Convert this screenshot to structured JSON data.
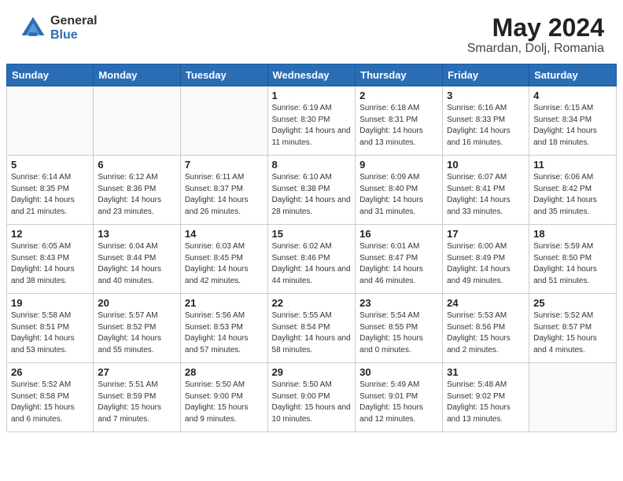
{
  "header": {
    "logo_general": "General",
    "logo_blue": "Blue",
    "month_year": "May 2024",
    "location": "Smardan, Dolj, Romania"
  },
  "weekdays": [
    "Sunday",
    "Monday",
    "Tuesday",
    "Wednesday",
    "Thursday",
    "Friday",
    "Saturday"
  ],
  "weeks": [
    [
      {
        "day": "",
        "sunrise": "",
        "sunset": "",
        "daylight": ""
      },
      {
        "day": "",
        "sunrise": "",
        "sunset": "",
        "daylight": ""
      },
      {
        "day": "",
        "sunrise": "",
        "sunset": "",
        "daylight": ""
      },
      {
        "day": "1",
        "sunrise": "6:19 AM",
        "sunset": "8:30 PM",
        "daylight": "14 hours and 11 minutes."
      },
      {
        "day": "2",
        "sunrise": "6:18 AM",
        "sunset": "8:31 PM",
        "daylight": "14 hours and 13 minutes."
      },
      {
        "day": "3",
        "sunrise": "6:16 AM",
        "sunset": "8:33 PM",
        "daylight": "14 hours and 16 minutes."
      },
      {
        "day": "4",
        "sunrise": "6:15 AM",
        "sunset": "8:34 PM",
        "daylight": "14 hours and 18 minutes."
      }
    ],
    [
      {
        "day": "5",
        "sunrise": "6:14 AM",
        "sunset": "8:35 PM",
        "daylight": "14 hours and 21 minutes."
      },
      {
        "day": "6",
        "sunrise": "6:12 AM",
        "sunset": "8:36 PM",
        "daylight": "14 hours and 23 minutes."
      },
      {
        "day": "7",
        "sunrise": "6:11 AM",
        "sunset": "8:37 PM",
        "daylight": "14 hours and 26 minutes."
      },
      {
        "day": "8",
        "sunrise": "6:10 AM",
        "sunset": "8:38 PM",
        "daylight": "14 hours and 28 minutes."
      },
      {
        "day": "9",
        "sunrise": "6:09 AM",
        "sunset": "8:40 PM",
        "daylight": "14 hours and 31 minutes."
      },
      {
        "day": "10",
        "sunrise": "6:07 AM",
        "sunset": "8:41 PM",
        "daylight": "14 hours and 33 minutes."
      },
      {
        "day": "11",
        "sunrise": "6:06 AM",
        "sunset": "8:42 PM",
        "daylight": "14 hours and 35 minutes."
      }
    ],
    [
      {
        "day": "12",
        "sunrise": "6:05 AM",
        "sunset": "8:43 PM",
        "daylight": "14 hours and 38 minutes."
      },
      {
        "day": "13",
        "sunrise": "6:04 AM",
        "sunset": "8:44 PM",
        "daylight": "14 hours and 40 minutes."
      },
      {
        "day": "14",
        "sunrise": "6:03 AM",
        "sunset": "8:45 PM",
        "daylight": "14 hours and 42 minutes."
      },
      {
        "day": "15",
        "sunrise": "6:02 AM",
        "sunset": "8:46 PM",
        "daylight": "14 hours and 44 minutes."
      },
      {
        "day": "16",
        "sunrise": "6:01 AM",
        "sunset": "8:47 PM",
        "daylight": "14 hours and 46 minutes."
      },
      {
        "day": "17",
        "sunrise": "6:00 AM",
        "sunset": "8:49 PM",
        "daylight": "14 hours and 49 minutes."
      },
      {
        "day": "18",
        "sunrise": "5:59 AM",
        "sunset": "8:50 PM",
        "daylight": "14 hours and 51 minutes."
      }
    ],
    [
      {
        "day": "19",
        "sunrise": "5:58 AM",
        "sunset": "8:51 PM",
        "daylight": "14 hours and 53 minutes."
      },
      {
        "day": "20",
        "sunrise": "5:57 AM",
        "sunset": "8:52 PM",
        "daylight": "14 hours and 55 minutes."
      },
      {
        "day": "21",
        "sunrise": "5:56 AM",
        "sunset": "8:53 PM",
        "daylight": "14 hours and 57 minutes."
      },
      {
        "day": "22",
        "sunrise": "5:55 AM",
        "sunset": "8:54 PM",
        "daylight": "14 hours and 58 minutes."
      },
      {
        "day": "23",
        "sunrise": "5:54 AM",
        "sunset": "8:55 PM",
        "daylight": "15 hours and 0 minutes."
      },
      {
        "day": "24",
        "sunrise": "5:53 AM",
        "sunset": "8:56 PM",
        "daylight": "15 hours and 2 minutes."
      },
      {
        "day": "25",
        "sunrise": "5:52 AM",
        "sunset": "8:57 PM",
        "daylight": "15 hours and 4 minutes."
      }
    ],
    [
      {
        "day": "26",
        "sunrise": "5:52 AM",
        "sunset": "8:58 PM",
        "daylight": "15 hours and 6 minutes."
      },
      {
        "day": "27",
        "sunrise": "5:51 AM",
        "sunset": "8:59 PM",
        "daylight": "15 hours and 7 minutes."
      },
      {
        "day": "28",
        "sunrise": "5:50 AM",
        "sunset": "9:00 PM",
        "daylight": "15 hours and 9 minutes."
      },
      {
        "day": "29",
        "sunrise": "5:50 AM",
        "sunset": "9:00 PM",
        "daylight": "15 hours and 10 minutes."
      },
      {
        "day": "30",
        "sunrise": "5:49 AM",
        "sunset": "9:01 PM",
        "daylight": "15 hours and 12 minutes."
      },
      {
        "day": "31",
        "sunrise": "5:48 AM",
        "sunset": "9:02 PM",
        "daylight": "15 hours and 13 minutes."
      },
      {
        "day": "",
        "sunrise": "",
        "sunset": "",
        "daylight": ""
      }
    ]
  ]
}
